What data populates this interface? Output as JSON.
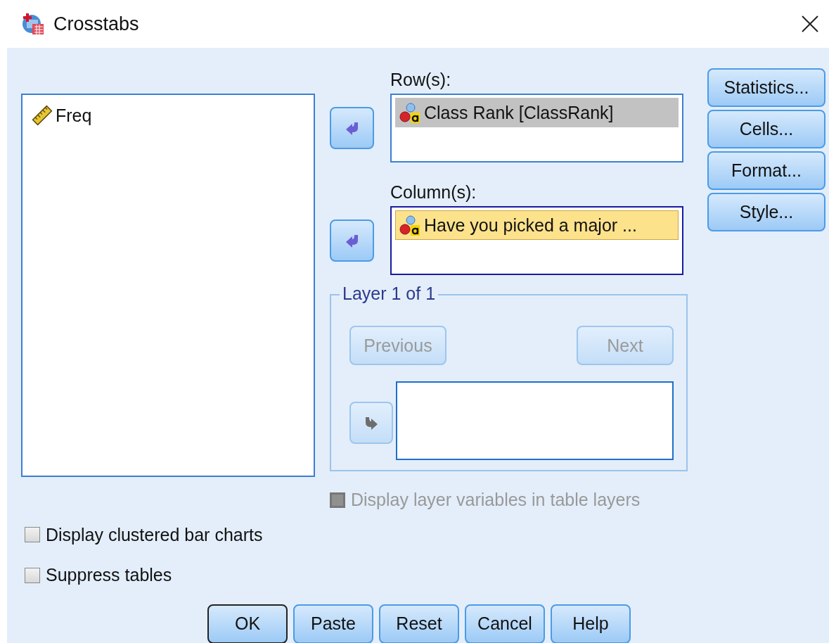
{
  "window": {
    "title": "Crosstabs"
  },
  "source_list": {
    "items": [
      {
        "label": "Freq",
        "kind": "scale",
        "selected": false
      }
    ]
  },
  "row_list": {
    "label": "Row(s):",
    "focused": false,
    "move_disabled": false,
    "items": [
      {
        "label": "Class Rank [ClassRank]",
        "kind": "nominal",
        "selected": true
      }
    ]
  },
  "column_list": {
    "label": "Column(s):",
    "focused": true,
    "move_disabled": false,
    "items": [
      {
        "label": "Have you picked a major ...",
        "kind": "nominal",
        "selected": true
      }
    ]
  },
  "side_buttons": [
    {
      "label": "Statistics..."
    },
    {
      "label": "Cells..."
    },
    {
      "label": "Format..."
    },
    {
      "label": "Style..."
    }
  ],
  "layer": {
    "title": "Layer 1 of 1",
    "previous": {
      "label": "Previous",
      "disabled": true
    },
    "next": {
      "label": "Next",
      "disabled": true
    },
    "move_disabled": true
  },
  "layer_option": {
    "label": "Display layer variables in table layers",
    "checked": false,
    "disabled": true
  },
  "options": [
    {
      "label": "Display clustered bar charts",
      "checked": false,
      "disabled": false
    },
    {
      "label": "Suppress tables",
      "checked": false,
      "disabled": false
    }
  ],
  "buttons": [
    {
      "label": "OK",
      "default": true
    },
    {
      "label": "Paste",
      "default": false
    },
    {
      "label": "Reset",
      "default": false
    },
    {
      "label": "Cancel",
      "default": false
    },
    {
      "label": "Help",
      "default": false
    }
  ]
}
